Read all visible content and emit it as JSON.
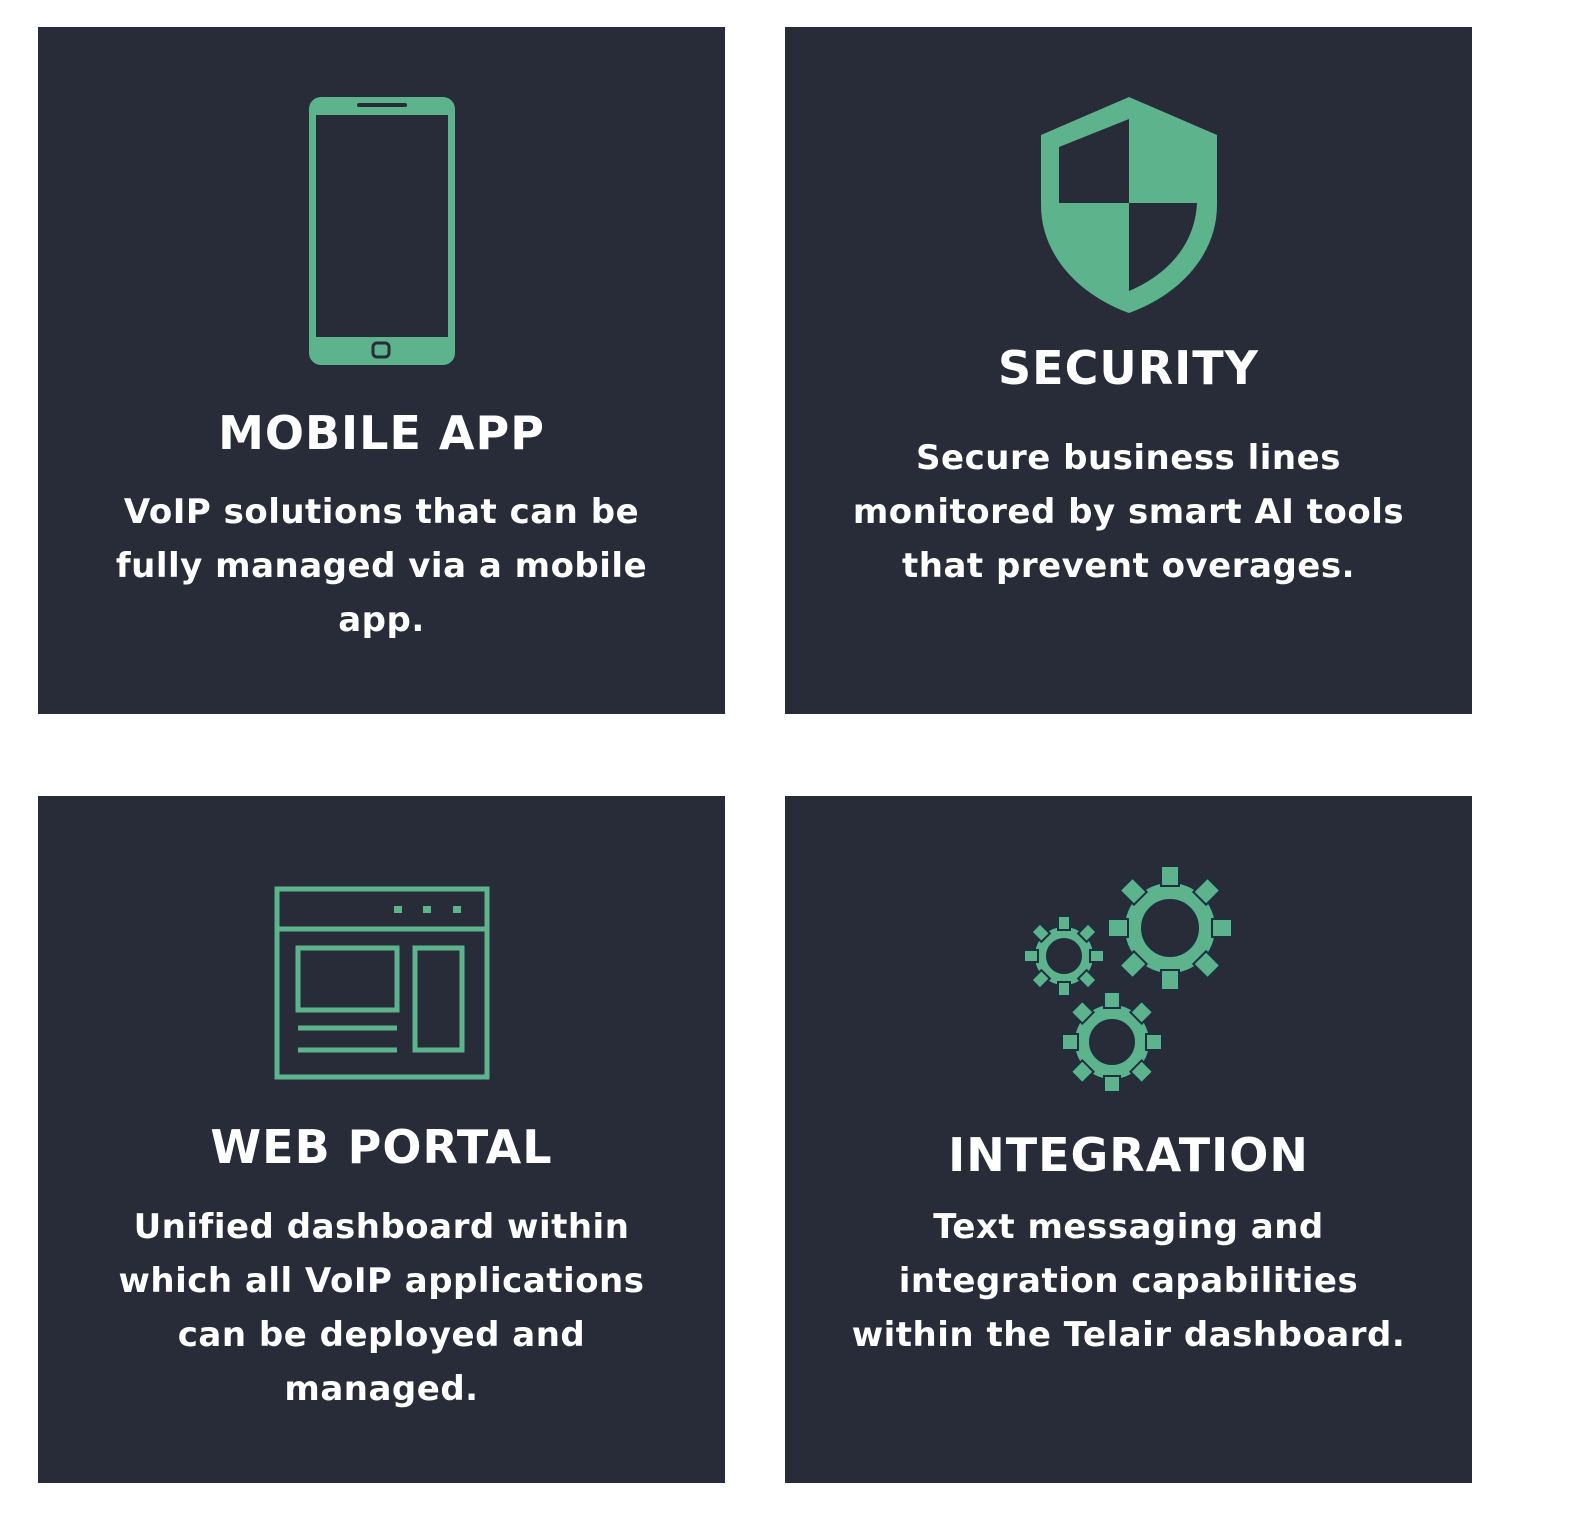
{
  "colors": {
    "card_background": "#282c38",
    "accent": "#5db38c",
    "text": "#ffffff",
    "page_background": "#ffffff"
  },
  "cards": [
    {
      "icon": "mobile-phone-icon",
      "title": "MOBILE APP",
      "description": "VoIP solutions that can be fully managed via a mobile app."
    },
    {
      "icon": "shield-icon",
      "title": "SECURITY",
      "description": "Secure business lines monitored by smart AI tools that prevent overages."
    },
    {
      "icon": "browser-window-icon",
      "title": "WEB PORTAL",
      "description": "Unified dashboard within which all VoIP applications can be deployed and managed."
    },
    {
      "icon": "gears-icon",
      "title": "INTEGRATION",
      "description": "Text messaging and integration capabilities within the Telair dashboard."
    }
  ]
}
